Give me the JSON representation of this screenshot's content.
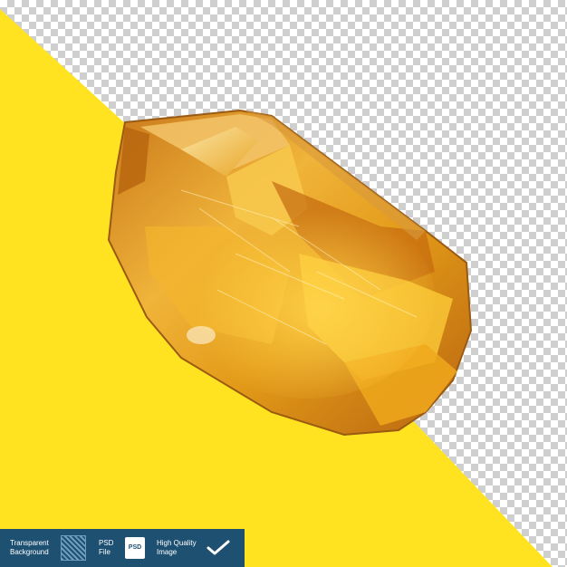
{
  "colors": {
    "yellow": "#ffe321",
    "checker_light": "#ffffff",
    "checker_dark": "#cfcfcf",
    "badge_bg": "#1e5072",
    "crystal_amber": "#e8a21b"
  },
  "badges": [
    {
      "label": "Transparent\nBackground",
      "icon": "hatch-pattern-icon"
    },
    {
      "label": "PSD\nFile",
      "icon": "psd-file-icon",
      "icon_text": "PSD"
    },
    {
      "label": "High Quality\nImage",
      "icon": "checkmark-icon"
    }
  ]
}
